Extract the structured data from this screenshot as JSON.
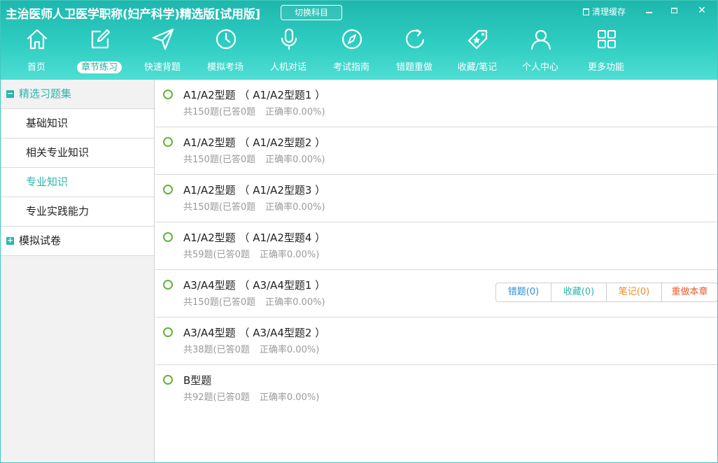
{
  "app": {
    "title": "主治医师人卫医学职称(妇产科学)精选版[试用版]",
    "switch_subject": "切换科目",
    "clear_cache": "清理缓存"
  },
  "nav": [
    {
      "label": "首页",
      "icon": "home-icon"
    },
    {
      "label": "章节练习",
      "icon": "edit-icon",
      "active": true
    },
    {
      "label": "快速背题",
      "icon": "send-icon"
    },
    {
      "label": "模拟考场",
      "icon": "clock-icon"
    },
    {
      "label": "人机对话",
      "icon": "microphone-icon"
    },
    {
      "label": "考试指南",
      "icon": "compass-icon"
    },
    {
      "label": "错题重做",
      "icon": "redo-icon"
    },
    {
      "label": "收藏/笔记",
      "icon": "tag-star-icon"
    },
    {
      "label": "个人中心",
      "icon": "user-icon"
    },
    {
      "label": "更多功能",
      "icon": "grid-icon"
    }
  ],
  "sidebar": {
    "groups": [
      {
        "label": "精选习题集",
        "toggle": "−",
        "expanded": true,
        "items": [
          {
            "label": "基础知识"
          },
          {
            "label": "相关专业知识"
          },
          {
            "label": "专业知识",
            "active": true
          },
          {
            "label": "专业实践能力"
          }
        ]
      },
      {
        "label": "模拟试卷",
        "toggle": "+",
        "expanded": false,
        "items": []
      }
    ]
  },
  "chapters": [
    {
      "title": "A1/A2型题 （ A1/A2型题1 ）",
      "stats": "共150题(已答0题",
      "rate": "正确率0.00%)"
    },
    {
      "title": "A1/A2型题 （ A1/A2型题2 ）",
      "stats": "共150题(已答0题",
      "rate": "正确率0.00%)"
    },
    {
      "title": "A1/A2型题 （ A1/A2型题3 ）",
      "stats": "共150题(已答0题",
      "rate": "正确率0.00%)"
    },
    {
      "title": "A1/A2型题 （ A1/A2型题4 ）",
      "stats": "共59题(已答0题",
      "rate": "正确率0.00%)"
    },
    {
      "title": "A3/A4型题 （ A3/A4型题1 ）",
      "stats": "共150题(已答0题",
      "rate": "正确率0.00%)"
    },
    {
      "title": "A3/A4型题 （ A3/A4型题2 ）",
      "stats": "共38题(已答0题",
      "rate": "正确率0.00%)"
    },
    {
      "title": "B型题",
      "stats": "共92题(已答0题",
      "rate": "正确率0.00%)"
    }
  ],
  "chapter_actions": {
    "wrong": "错题(0)",
    "favorite": "收藏(0)",
    "note": "笔记(0)",
    "redo": "重做本章"
  },
  "colors": {
    "accent": "#2bb6ac",
    "header_top": "#1fb7ad",
    "header_bottom": "#4fded4",
    "circle": "#62b43a",
    "wrong": "#2a8fd6",
    "note": "#f08c20",
    "redo": "#e55a2a"
  }
}
